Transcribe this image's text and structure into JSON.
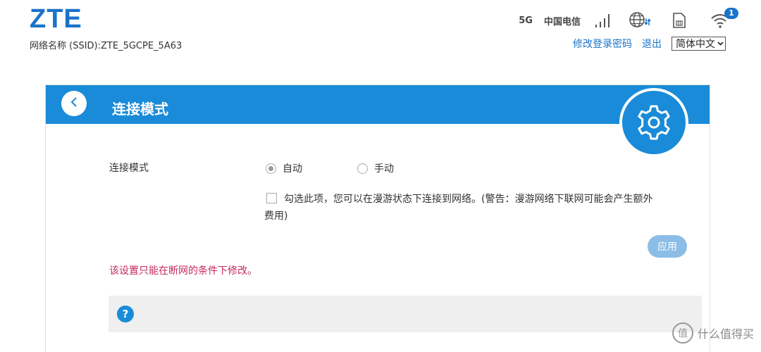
{
  "header": {
    "logo": "ZTE",
    "ssid_label": "网络名称 (SSID):",
    "ssid_value": "ZTE_5GCPE_5A63",
    "status": {
      "network_type": "5G",
      "carrier": "中国电信",
      "wifi_badge": "1",
      "icons": [
        "signal-icon",
        "globe-data-icon",
        "sim-card-icon",
        "wifi-icon"
      ]
    },
    "links": {
      "change_password": "修改登录密码",
      "logout": "退出",
      "language": "简体中文"
    }
  },
  "panel": {
    "title": "连接模式",
    "mode_label": "连接模式",
    "mode_options": [
      {
        "label": "自动",
        "selected": true
      },
      {
        "label": "手动",
        "selected": false
      }
    ],
    "roaming_text": "勾选此项，您可以在漫游状态下连接到网络。(警告：漫游网络下联网可能会产生额外费用)",
    "roaming_checked": false,
    "apply_label": "应用",
    "warning": "该设置只能在断网的条件下修改。",
    "help_symbol": "?"
  },
  "watermark": {
    "text": "什么值得买",
    "glyph": "值"
  },
  "colors": {
    "accent": "#1a8bd8",
    "link": "#1a73c9",
    "warning": "#c5285a",
    "apply_disabled": "#8bbde6"
  }
}
